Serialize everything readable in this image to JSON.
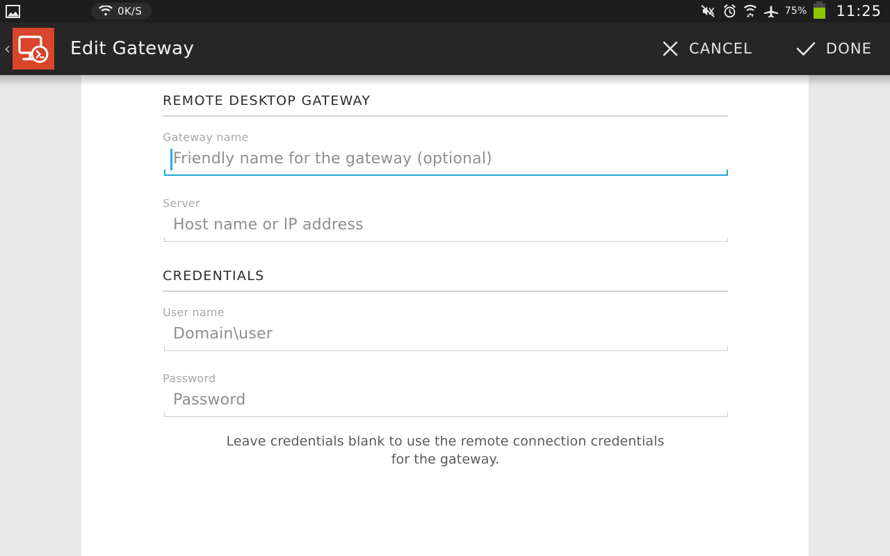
{
  "status_bar": {
    "gallery_icon": "image-icon",
    "network_speed": "0K/S",
    "wifi_icon": "wifi-icon",
    "right_icons": [
      {
        "name": "mute-vibrate-icon"
      },
      {
        "name": "alarm-clock-icon"
      },
      {
        "name": "wifi-data-icon"
      },
      {
        "name": "airplane-mode-icon"
      }
    ],
    "battery_percent": "75%",
    "battery_icon": "battery-icon",
    "time": "11:25"
  },
  "action_bar": {
    "back_icon": "back-chevron-icon",
    "app_icon": "remote-desktop-icon",
    "title": "Edit Gateway",
    "cancel_label": "CANCEL",
    "cancel_icon": "close-x-icon",
    "done_label": "DONE",
    "done_icon": "checkmark-icon"
  },
  "form": {
    "sections": [
      {
        "heading": "REMOTE DESKTOP GATEWAY",
        "fields": [
          {
            "label": "Gateway name",
            "placeholder": "Friendly name for the gateway (optional)",
            "value": "",
            "focused": true
          },
          {
            "label": "Server",
            "placeholder": "Host name or IP address",
            "value": "",
            "focused": false
          }
        ]
      },
      {
        "heading": "CREDENTIALS",
        "fields": [
          {
            "label": "User name",
            "placeholder": "Domain\\user",
            "value": "",
            "focused": false
          },
          {
            "label": "Password",
            "placeholder": "Password",
            "value": "",
            "focused": false
          }
        ]
      }
    ],
    "hint_line_1": "Leave credentials blank to use the remote connection credentials",
    "hint_line_2": "for the gateway."
  },
  "colors": {
    "accent_blue": "#22a5dd",
    "app_icon_orange": "#d9452a",
    "battery_green": "#8cc400",
    "action_bar_dark": "#262626",
    "status_bar_dark": "#1d1d1d"
  }
}
